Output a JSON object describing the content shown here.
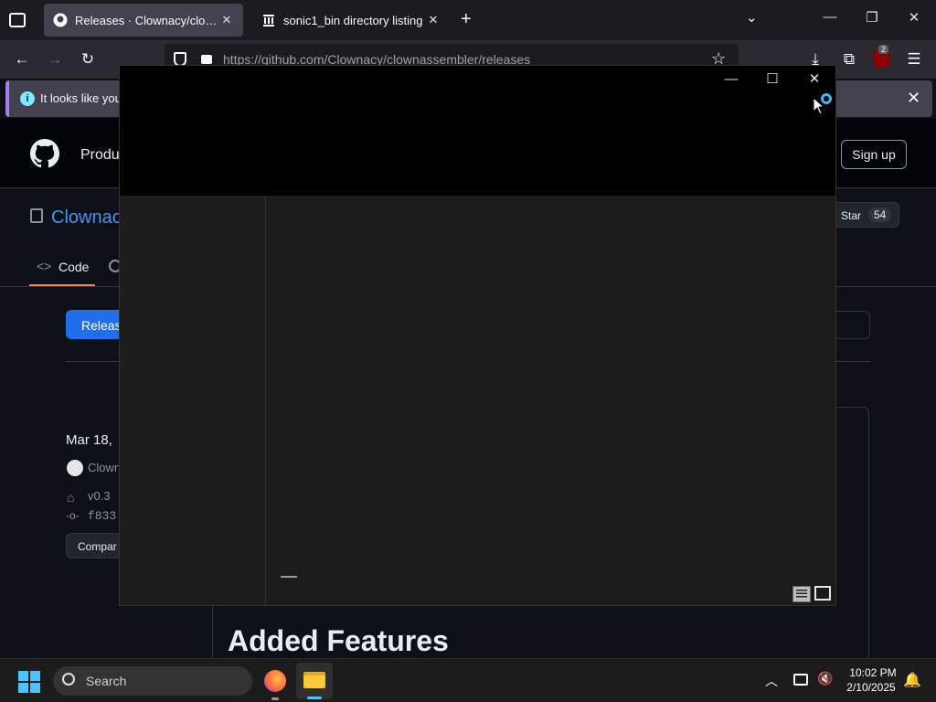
{
  "browser": {
    "tabs": [
      {
        "label": "Releases · Clownacy/clownassembler",
        "icon": "github-icon",
        "active": true
      },
      {
        "label": "sonic1_bin directory listing",
        "icon": "archive-icon",
        "active": false
      }
    ],
    "url": "https://github.com/Clownacy/clownassembler/releases",
    "notification": "It looks like you h",
    "extension_badge": "2"
  },
  "github": {
    "nav_product": "Produ",
    "signup": "Sign up",
    "repo_name": "Clownac",
    "star_label": "Star",
    "star_count": "54",
    "tab_code": "Code",
    "releases_tab": "Release",
    "release": {
      "date": "Mar 18,",
      "author": "Clown",
      "tag": "v0.3",
      "commit": "f833",
      "compare": "Compar",
      "heading": "Added Features"
    }
  },
  "overlay_window": {
    "minimize": "—",
    "maximize": "☐",
    "close": "✕"
  },
  "taskbar": {
    "search": "Search",
    "time": "10:02 PM",
    "date": "2/10/2025"
  },
  "colors": {
    "accent_blue": "#1f6feb",
    "link_blue": "#4493f8",
    "notice_border": "#a47ff0"
  }
}
